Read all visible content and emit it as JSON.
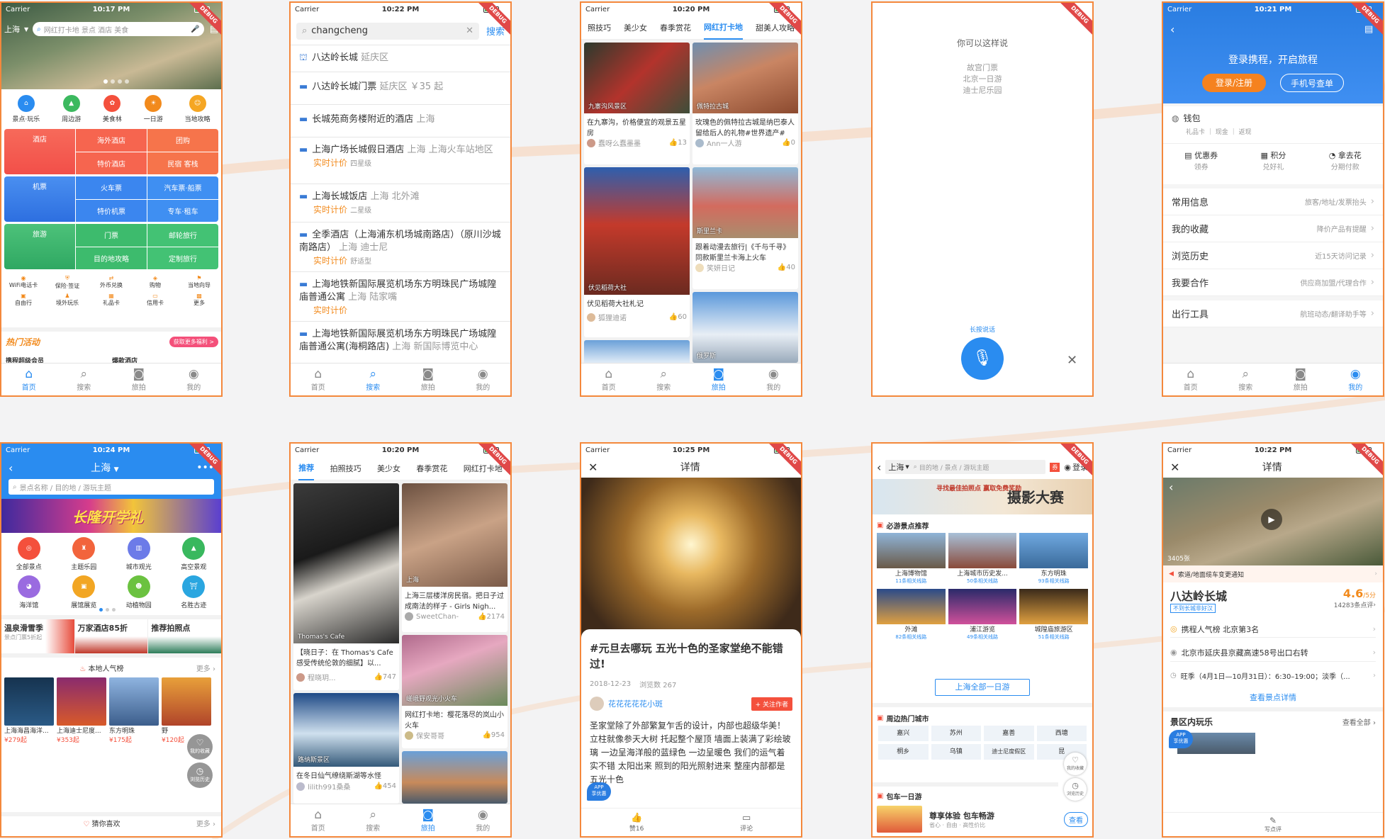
{
  "colors": {
    "accent": "#2a8cf0",
    "frame": "#f4883c",
    "red": "#f4503c",
    "blue": "#2a7de1",
    "green": "#31b16a",
    "orange": "#f28a1c"
  },
  "debug": "DEBUG",
  "tabbar": {
    "home": "首页",
    "search": "搜索",
    "travel": "旅拍",
    "mine": "我的"
  },
  "s1": {
    "carrier": "Carrier",
    "time": "10:17 PM",
    "city": "上海",
    "search_placeholder": "网红打卡地 景点 酒店 美食",
    "icons": [
      {
        "icon": "attraction-icon",
        "label": "景点·玩乐"
      },
      {
        "icon": "nearby-icon",
        "label": "周边游"
      },
      {
        "icon": "food-icon",
        "label": "美食林"
      },
      {
        "icon": "day-tour-icon",
        "label": "一日游"
      },
      {
        "icon": "guide-icon",
        "label": "当地攻略"
      }
    ],
    "hotel": {
      "main": "酒店",
      "a": "海外酒店",
      "b": "团购",
      "c": "特价酒店",
      "d": "民宿 客栈"
    },
    "flight": {
      "main": "机票",
      "a": "火车票",
      "b": "汽车票·船票",
      "c": "特价机票",
      "d": "专车·租车"
    },
    "travel": {
      "main": "旅游",
      "a": "门票",
      "b": "邮轮旅行",
      "c": "目的地攻略",
      "d": "定制旅行"
    },
    "small": [
      "WiFi电话卡",
      "保险·签证",
      "外币兑换",
      "购物",
      "当地向导",
      "自由行",
      "境外玩乐",
      "礼品卡",
      "信用卡",
      "更多"
    ],
    "hot_title": "热门活动",
    "hot_more": "获取更多福利 >",
    "more_a": "携程超级会员",
    "more_b": "爆款酒店"
  },
  "s2": {
    "carrier": "Carrier",
    "time": "10:22 PM",
    "query": "changcheng",
    "search_btn": "搜索",
    "items": [
      {
        "name": "八达岭长城",
        "sub": "延庆区",
        "rt": ""
      },
      {
        "name": "八达岭长城门票",
        "sub": "延庆区 ￥35 起",
        "rt": ""
      },
      {
        "name": "长城苑商务楼附近的酒店",
        "sub": "上海",
        "rt": ""
      },
      {
        "name": "上海广场长城假日酒店",
        "sub": "上海 上海火车站地区",
        "rt": "实时计价",
        "tag": "四星级"
      },
      {
        "name": "上海长城饭店",
        "sub": "上海 北外滩",
        "rt": "实时计价",
        "tag": "二星级"
      },
      {
        "name": "全季酒店（上海浦东机场城南路店）（原川沙城南路店）",
        "sub": "上海 迪士尼",
        "rt": "实时计价",
        "tag": "舒适型"
      },
      {
        "name": "上海地铁新国际展览机场东方明珠民广场城隍庙普通公寓",
        "sub": "上海 陆家嘴",
        "rt": "实时计价"
      },
      {
        "name": "上海地铁新国际展览机场东方明珠民广场城隍庙普通公寓(海桐路店)",
        "sub": "上海 新国际博览中心",
        "rt": ""
      }
    ]
  },
  "s3": {
    "carrier": "Carrier",
    "time": "10:20 PM",
    "tabs": [
      "照技巧",
      "美少女",
      "春季赏花",
      "网红打卡地",
      "甜美人攻略"
    ],
    "cards": [
      {
        "loc": "九寨沟风景区",
        "title": "在九寨沟，价格便宜的观景五星房",
        "user": "蠢呀么蠢墨墨",
        "likes": "13"
      },
      {
        "loc": "佩特拉古城",
        "title": "玫瑰色的佩特拉古城是纳巴泰人留给后人的礼物#世界遗产#",
        "user": "Ann一人游",
        "likes": "0"
      },
      {
        "loc": "伏见稻荷大社",
        "title": "伏见稻荷大社札记",
        "user": "狐狸迪诺",
        "likes": "60"
      },
      {
        "loc": "斯里兰卡",
        "title": "跟着动漫去旅行|《千与千寻》同款斯里兰卡海上火车",
        "user": "笑妍日记",
        "likes": "40"
      },
      {
        "loc": "俄罗斯",
        "title": ""
      }
    ]
  },
  "s4": {
    "hint": "你可以这样说",
    "examples": [
      "故宫门票",
      "北京一日游",
      "迪士尼乐园"
    ],
    "longpress": "长按说话"
  },
  "s5": {
    "carrier": "Carrier",
    "time": "10:21 PM",
    "banner": "登录携程，开启旅程",
    "login": "登录/注册",
    "phone": "手机号查单",
    "wallet": "钱包",
    "wallet_sub": "礼品卡 ｜ 现金 ｜ 返现",
    "perks": [
      {
        "t": "优惠券",
        "s": "领券"
      },
      {
        "t": "积分",
        "s": "兑好礼"
      },
      {
        "t": "拿去花",
        "s": "分期付款"
      }
    ],
    "rows": [
      {
        "l": "常用信息",
        "r": "旅客/地址/发票抬头"
      },
      {
        "l": "我的收藏",
        "r": "降价产品有提醒"
      },
      {
        "l": "浏览历史",
        "r": "近15天访问记录"
      },
      {
        "l": "我要合作",
        "r": "供应商加盟/代理合作"
      },
      {
        "l": "出行工具",
        "r": "航班动态/翻译助手等"
      }
    ]
  },
  "s6": {
    "carrier": "Carrier",
    "time": "10:24 PM",
    "city": "上海",
    "search_placeholder": "景点名称 / 目的地 / 游玩主题",
    "banner": "长隆开学礼",
    "icons": [
      "全部景点",
      "主题乐园",
      "城市观光",
      "高空景观",
      "海洋馆",
      "展馆展览",
      "动植物园",
      "名胜古迹"
    ],
    "promos": [
      {
        "t": "温泉滑雪季",
        "s": "景点门票5折起"
      },
      {
        "t": "万家酒店85折",
        "s": ""
      },
      {
        "t": "推荐拍照点",
        "s": ""
      }
    ],
    "local_title": "本地人气榜",
    "more": "更多",
    "ranks": [
      {
        "n": "上海海昌海洋...",
        "p": "¥279起"
      },
      {
        "n": "上海迪士尼度...",
        "p": "¥353起"
      },
      {
        "n": "东方明珠",
        "p": "¥175起"
      },
      {
        "n": "野",
        "p": "¥120起"
      }
    ],
    "fav": "我的收藏",
    "history": "浏览历史",
    "guess": "猜你喜欢"
  },
  "s7": {
    "carrier": "Carrier",
    "time": "10:20 PM",
    "tabs": [
      "推荐",
      "拍照技巧",
      "美少女",
      "春季赏花",
      "网红打卡地"
    ],
    "cards": [
      {
        "loc": "Thomas's Cafe",
        "title": "【晓日子：在 Thomas's Cafe 感受传统伦敦的细腻】以...",
        "user": "程晓玥...",
        "likes": "747"
      },
      {
        "loc": "上海",
        "title": "上海三层楼洋房民宿。把日子过成南法的样子 - Girls Nigh...",
        "user": "SweetChan-",
        "likes": "2174"
      },
      {
        "loc": "嵯峨野观光小火车",
        "title": "网红打卡地：樱花落尽的岚山小火车",
        "user": "保安哥哥",
        "likes": "954"
      },
      {
        "loc": "路纳斯景区",
        "title": "在冬日仙气缭绕斯湖等水怪",
        "user": "lilith991桑桑",
        "likes": "454"
      }
    ]
  },
  "s8": {
    "carrier": "Carrier",
    "time": "10:25 PM",
    "header": "详情",
    "title": "#元旦去哪玩 五光十色的圣家堂绝不能错过!",
    "date": "2018-12-23",
    "views": "浏览数 267",
    "author": "花花花花花小斑",
    "follow": "+ 关注作者",
    "body": "圣家堂除了外部繁复乍舌的设计，内部也超级华美！立柱就像参天大树 托起整个屋顶 墙面上装满了彩绘玻璃 一边呈海洋般的蓝绿色 一边呈暖色 我们的运气着实不错 太阳出来 照到的阳光照射进来 整座内部都是五光十色",
    "app_a": "APP",
    "app_b": "享优惠",
    "like": "赞16",
    "comment": "评论"
  },
  "s9": {
    "city": "上海",
    "search_placeholder": "目的地 / 景点 / 游玩主题",
    "login": "登录",
    "banner": "摄影大赛",
    "banner_sub": "寻找最佳拍照点 赢取免费奖励",
    "must": "必游景点推荐",
    "spots": [
      {
        "n": "上海博物馆",
        "c": "11条相关线路"
      },
      {
        "n": "上海城市历史发...",
        "c": "50条相关线路"
      },
      {
        "n": "东方明珠",
        "c": "93条相关线路"
      },
      {
        "n": "外滩",
        "c": "82条相关线路"
      },
      {
        "n": "浦江游览",
        "c": "49条相关线路"
      },
      {
        "n": "城隍庙旅游区",
        "c": "51条相关线路"
      }
    ],
    "all": "上海全部一日游",
    "hot_city": "周边热门城市",
    "cities": [
      "嘉兴",
      "苏州",
      "嘉善",
      "西塘",
      "桐乡",
      "乌镇",
      "迪士尼度假区",
      "昆"
    ],
    "charter": "包车一日游",
    "charter_t": "尊享体验 包车畅游",
    "charter_s": "省心 · 自由 · 高性价比",
    "view": "查看",
    "fav": "我的收藏",
    "history": "浏览历史"
  },
  "s10": {
    "carrier": "Carrier",
    "time": "10:22 PM",
    "header": "详情",
    "img_count": "3405张",
    "notice": "索道/地面缆车变更通知",
    "name": "八达岭长城",
    "score": "4.6",
    "score_unit": "/5分",
    "reviews": "14283条点评",
    "tag": "不到长城非好汉",
    "rank": "携程人气榜 北京第3名",
    "address": "北京市延庆县京藏高速58号出口右转",
    "hours": "旺季（4月1日—10月31日）：6:30–19:00；淡季（...",
    "more": "查看景点详情",
    "play": "景区内玩乐",
    "all": "查看全部",
    "app_a": "APP",
    "app_b": "享优惠",
    "write": "写点评"
  }
}
